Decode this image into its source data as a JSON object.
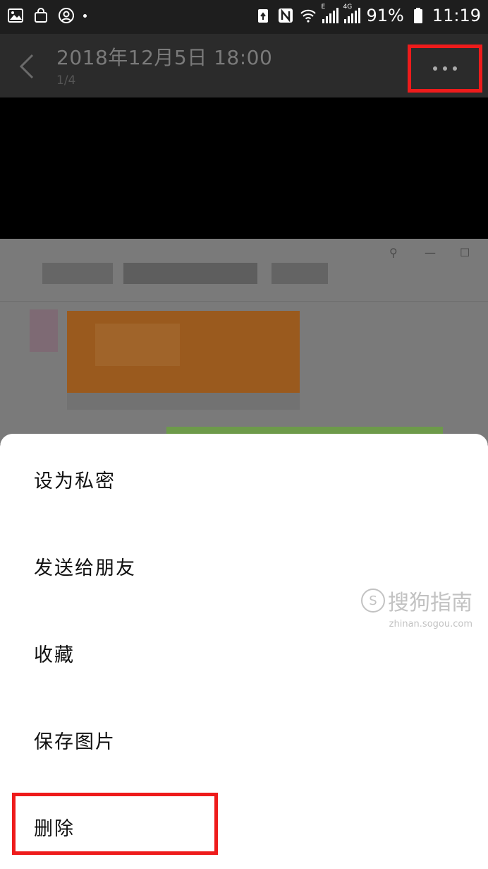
{
  "status_bar": {
    "battery": "91%",
    "time": "11:19",
    "network_small": "E",
    "network_4g": "4G"
  },
  "header": {
    "title": "2018年12月5日 18:00",
    "counter": "1/4"
  },
  "action_sheet": {
    "items": [
      "设为私密",
      "发送给朋友",
      "收藏",
      "保存图片",
      "删除"
    ]
  },
  "watermark": {
    "brand": "搜狗指南",
    "url": "zhinan.sogou.com"
  },
  "colors": {
    "highlight_red": "#ee1b1b",
    "sheet_bg": "#ffffff",
    "photo_orange": "#9a5a1e",
    "photo_green": "#6d9a4a"
  }
}
